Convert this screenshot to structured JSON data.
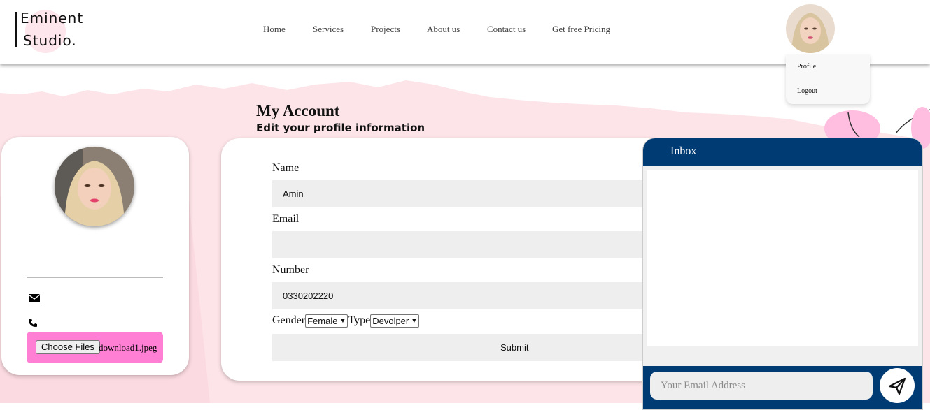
{
  "logo": {
    "line1": "Eminent",
    "line2": "Studio."
  },
  "nav": {
    "items": [
      {
        "label": "Home"
      },
      {
        "label": "Services"
      },
      {
        "label": "Projects"
      },
      {
        "label": "About us"
      },
      {
        "label": "Contact us"
      },
      {
        "label": "Get free Pricing"
      }
    ]
  },
  "user_menu": {
    "profile": "Profile",
    "logout": "Logout"
  },
  "page": {
    "title": "My Account",
    "subtitle": "Edit your profile information"
  },
  "profile_card": {
    "icons": [
      "envelope-icon",
      "phone-icon"
    ],
    "upload_button": "Choose Files",
    "file_name": "download1.jpeg"
  },
  "form": {
    "name_label": "Name",
    "name_value": "Amin",
    "email_label": "Email",
    "email_value": "",
    "number_label": "Number",
    "number_value": "0330202220",
    "gender_label": "Gender",
    "gender_value": "Female",
    "type_label": "Type",
    "type_value": "Devolper",
    "submit_label": "Submit"
  },
  "inbox": {
    "title": "Inbox",
    "email_placeholder": "Your Email Address",
    "send_icon": "paper-plane-icon"
  },
  "colors": {
    "nav_blue": "#003b73",
    "upload_pink": "#ff7fd5",
    "background_pink": "#fde4e8",
    "field_gray": "#eeeeee"
  }
}
